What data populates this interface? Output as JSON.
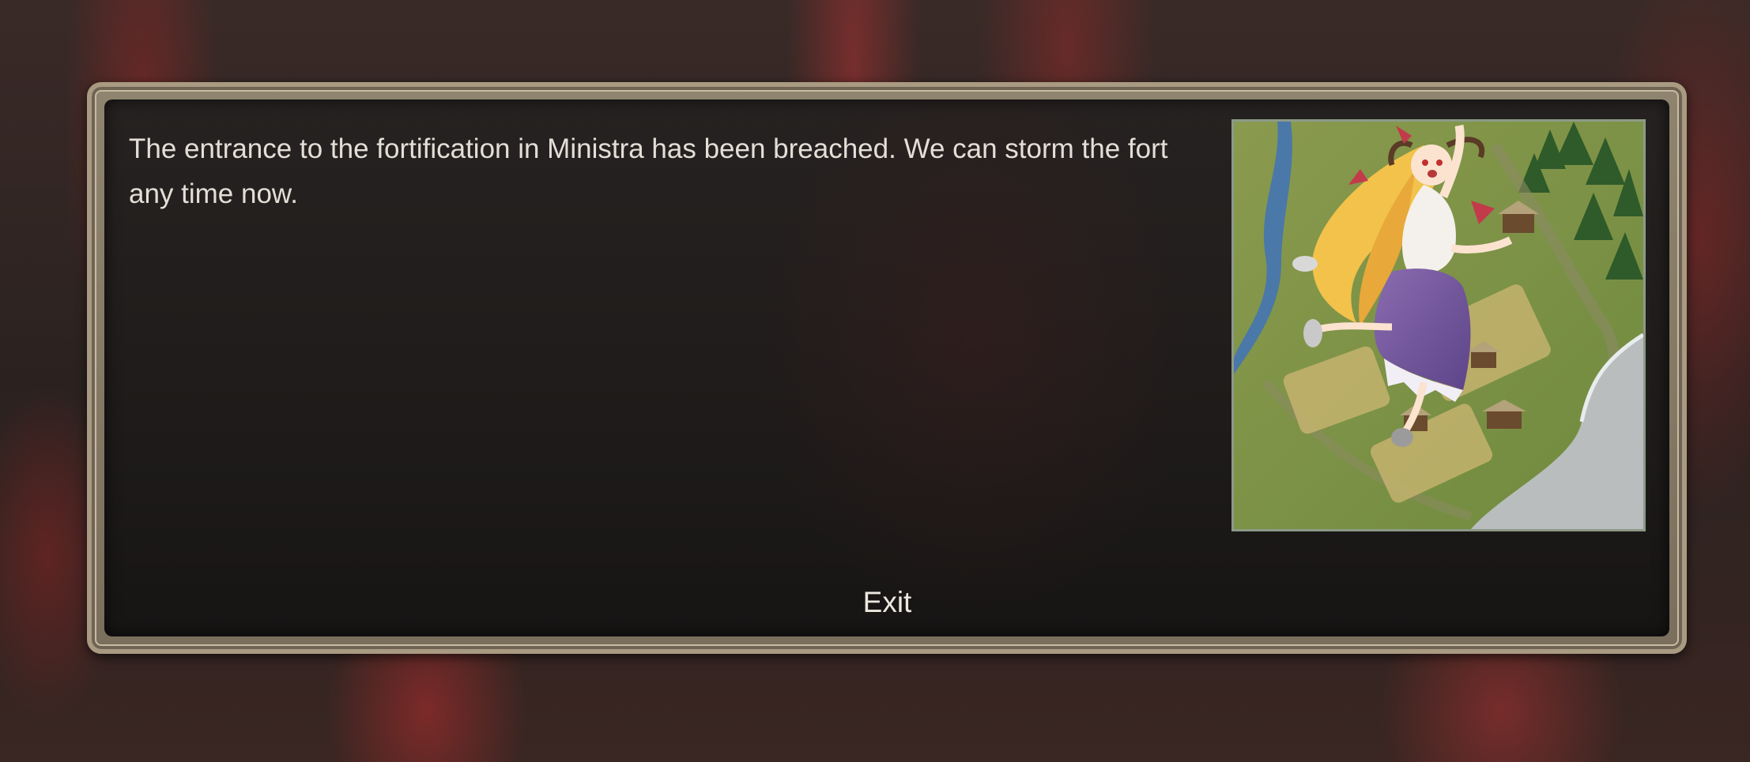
{
  "dialog": {
    "message": "The entrance to the fortification in Ministra has been breached. We can storm the fort any time now.",
    "exit_label": "Exit"
  },
  "image": {
    "subject": "blonde-horned-girl-leaping-over-village-map"
  },
  "colors": {
    "frame": "#a99a82",
    "panel": "#1e1b1a",
    "text": "#e3dfd7",
    "backdrop_red": "#a13535"
  }
}
